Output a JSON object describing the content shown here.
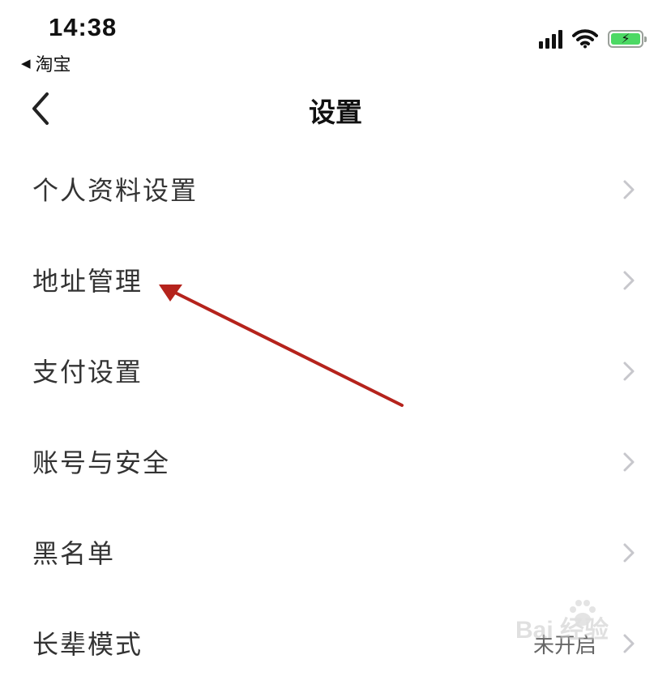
{
  "status_bar": {
    "time": "14:38",
    "back_app_label": "淘宝",
    "back_arrow_glyph": "◀",
    "battery_glyph": "⚡"
  },
  "nav": {
    "title": "设置",
    "back_icon": "chevron-left-icon"
  },
  "settings": [
    {
      "label": "个人资料设置",
      "value": ""
    },
    {
      "label": "地址管理",
      "value": ""
    },
    {
      "label": "支付设置",
      "value": ""
    },
    {
      "label": "账号与安全",
      "value": ""
    },
    {
      "label": "黑名单",
      "value": ""
    },
    {
      "label": "长辈模式",
      "value": "未开启"
    }
  ],
  "annotation": {
    "color": "#b5231c"
  },
  "watermark": {
    "text": "Bai  经验"
  },
  "colors": {
    "battery_fill": "#4cd964",
    "chevron": "#c7c7cc",
    "text": "#333333"
  }
}
